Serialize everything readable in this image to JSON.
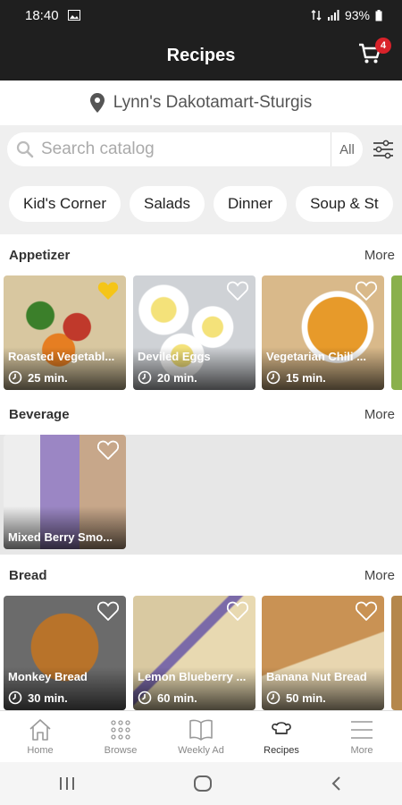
{
  "status": {
    "time": "18:40",
    "battery": "93%"
  },
  "header": {
    "title": "Recipes",
    "cart_count": "4"
  },
  "store": {
    "name": "Lynn's Dakotamart-Sturgis"
  },
  "search": {
    "placeholder": "Search catalog",
    "scope": "All"
  },
  "categories": [
    "Kid's Corner",
    "Salads",
    "Dinner",
    "Soup & St"
  ],
  "sections": [
    {
      "title": "Appetizer",
      "more": "More",
      "items": [
        {
          "name": "Roasted Vegetabl...",
          "time": "25 min.",
          "favorite": true
        },
        {
          "name": "Deviled Eggs",
          "time": "20 min.",
          "favorite": false
        },
        {
          "name": "Vegetarian Chili ...",
          "time": "15 min.",
          "favorite": false
        }
      ]
    },
    {
      "title": "Beverage",
      "more": "More",
      "items": [
        {
          "name": "Mixed Berry Smo...",
          "time": "",
          "favorite": false
        }
      ]
    },
    {
      "title": "Bread",
      "more": "More",
      "items": [
        {
          "name": "Monkey Bread",
          "time": "30 min.",
          "favorite": false
        },
        {
          "name": "Lemon Blueberry ...",
          "time": "60 min.",
          "favorite": false
        },
        {
          "name": "Banana Nut Bread",
          "time": "50 min.",
          "favorite": false
        }
      ]
    }
  ],
  "bottom_nav": [
    {
      "label": "Home",
      "icon": "home-icon"
    },
    {
      "label": "Browse",
      "icon": "grid-icon"
    },
    {
      "label": "Weekly Ad",
      "icon": "book-icon"
    },
    {
      "label": "Recipes",
      "icon": "chef-hat-icon",
      "active": true
    },
    {
      "label": "More",
      "icon": "menu-icon"
    }
  ],
  "colors": {
    "appbar": "#1f1f1f",
    "badge": "#d9222a",
    "favorite": "#f5c518"
  }
}
